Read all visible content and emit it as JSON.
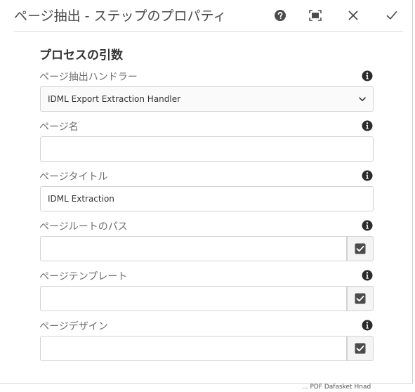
{
  "dialog": {
    "title": "ページ抽出 - ステップのプロパティ",
    "icons": {
      "help": "help-icon",
      "fullscreen": "fullscreen-icon",
      "close": "close-icon",
      "done": "checkmark-icon"
    }
  },
  "section": {
    "title": "プロセスの引数"
  },
  "fields": {
    "handler": {
      "label": "ページ抽出ハンドラー",
      "value": "IDML Export Extraction Handler"
    },
    "page_name": {
      "label": "ページ名",
      "value": ""
    },
    "page_title": {
      "label": "ページタイトル",
      "value": "IDML Extraction"
    },
    "root_path": {
      "label": "ページルートのパス",
      "value": ""
    },
    "template": {
      "label": "ページテンプレート",
      "value": ""
    },
    "design": {
      "label": "ページデザイン",
      "value": ""
    }
  },
  "background_text": "... PDF Dafasket Hnad"
}
